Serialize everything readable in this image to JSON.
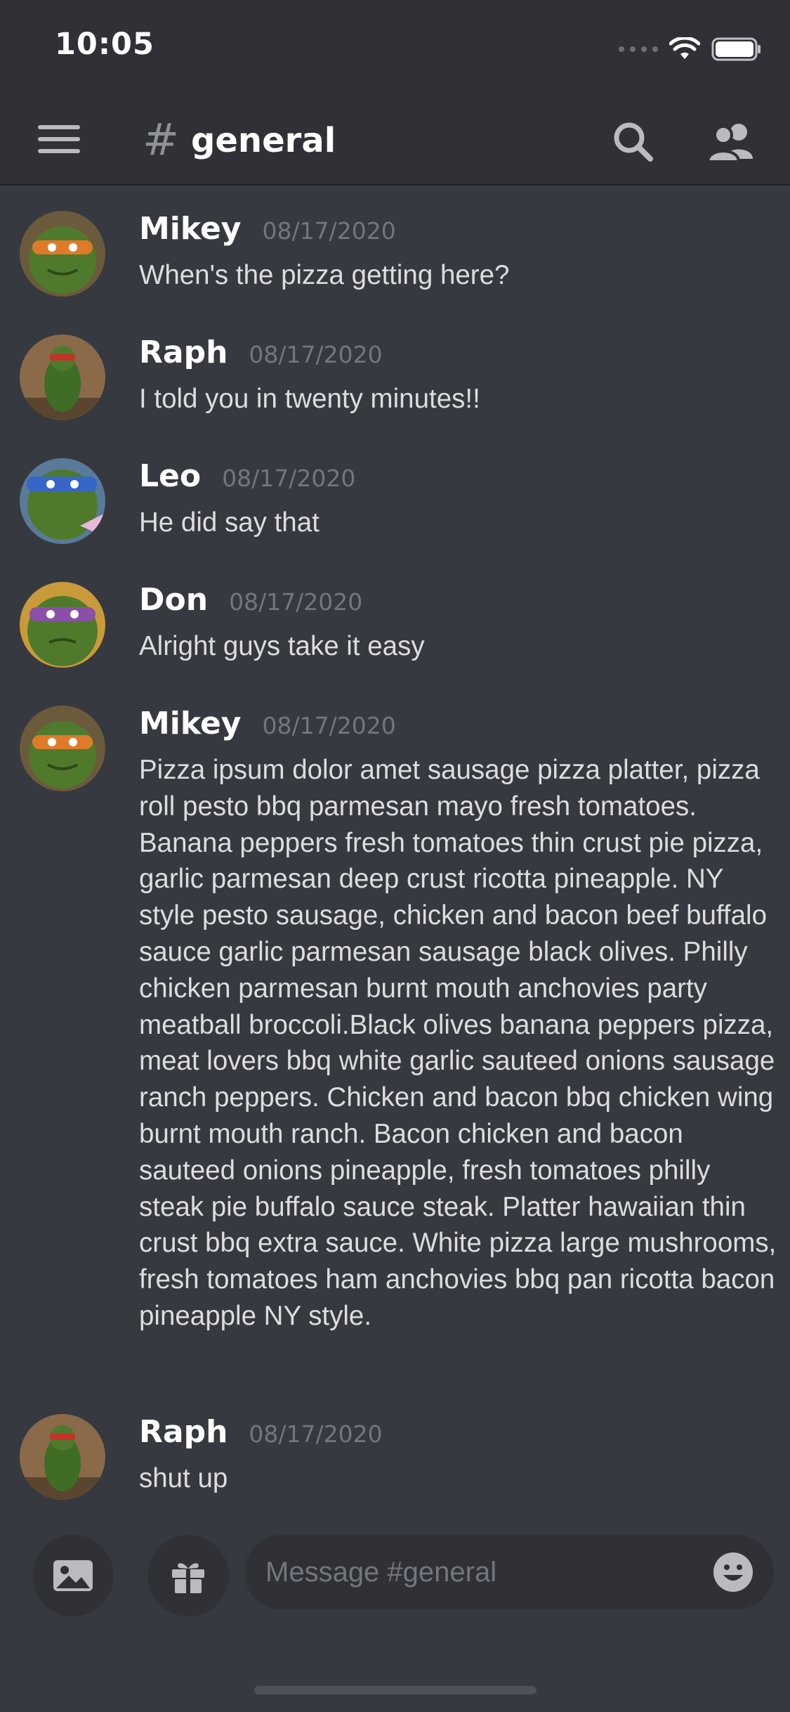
{
  "status_bar": {
    "time": "10:05"
  },
  "header": {
    "hash": "#",
    "channel": "general"
  },
  "messages": [
    {
      "author": "Mikey",
      "timestamp": "08/17/2020",
      "text": "When's the pizza getting here?",
      "avatar_color": "#e07a2b"
    },
    {
      "author": "Raph",
      "timestamp": "08/17/2020",
      "text": "I told you in twenty minutes!!",
      "avatar_color": "#c8302b"
    },
    {
      "author": "Leo",
      "timestamp": "08/17/2020",
      "text": "He did say that",
      "avatar_color": "#3566c8"
    },
    {
      "author": "Don",
      "timestamp": "08/17/2020",
      "text": "Alright guys take it easy",
      "avatar_color": "#8a4fa8"
    },
    {
      "author": "Mikey",
      "timestamp": "08/17/2020",
      "text": "Pizza ipsum dolor amet sausage pizza platter, pizza roll pesto bbq parmesan mayo fresh tomatoes. Banana peppers fresh tomatoes thin crust pie pizza, garlic parmesan deep crust ricotta pineapple. NY style pesto sausage, chicken and bacon beef buffalo sauce garlic parmesan sausage black olives. Philly chicken parmesan burnt mouth anchovies party meatball broccoli.Black olives banana peppers pizza, meat lovers bbq white garlic sauteed onions sausage ranch peppers. Chicken and bacon bbq chicken wing burnt mouth ranch. Bacon chicken and bacon sauteed onions pineapple, fresh tomatoes philly steak pie buffalo sauce steak. Platter hawaiian thin crust bbq extra sauce. White pizza large mushrooms, fresh tomatoes ham anchovies bbq pan ricotta bacon pineapple NY style.",
      "avatar_color": "#e07a2b"
    },
    {
      "author": "Raph",
      "timestamp": "08/17/2020",
      "text": "shut up",
      "avatar_color": "#c8302b"
    }
  ],
  "composer": {
    "placeholder": "Message #general"
  }
}
